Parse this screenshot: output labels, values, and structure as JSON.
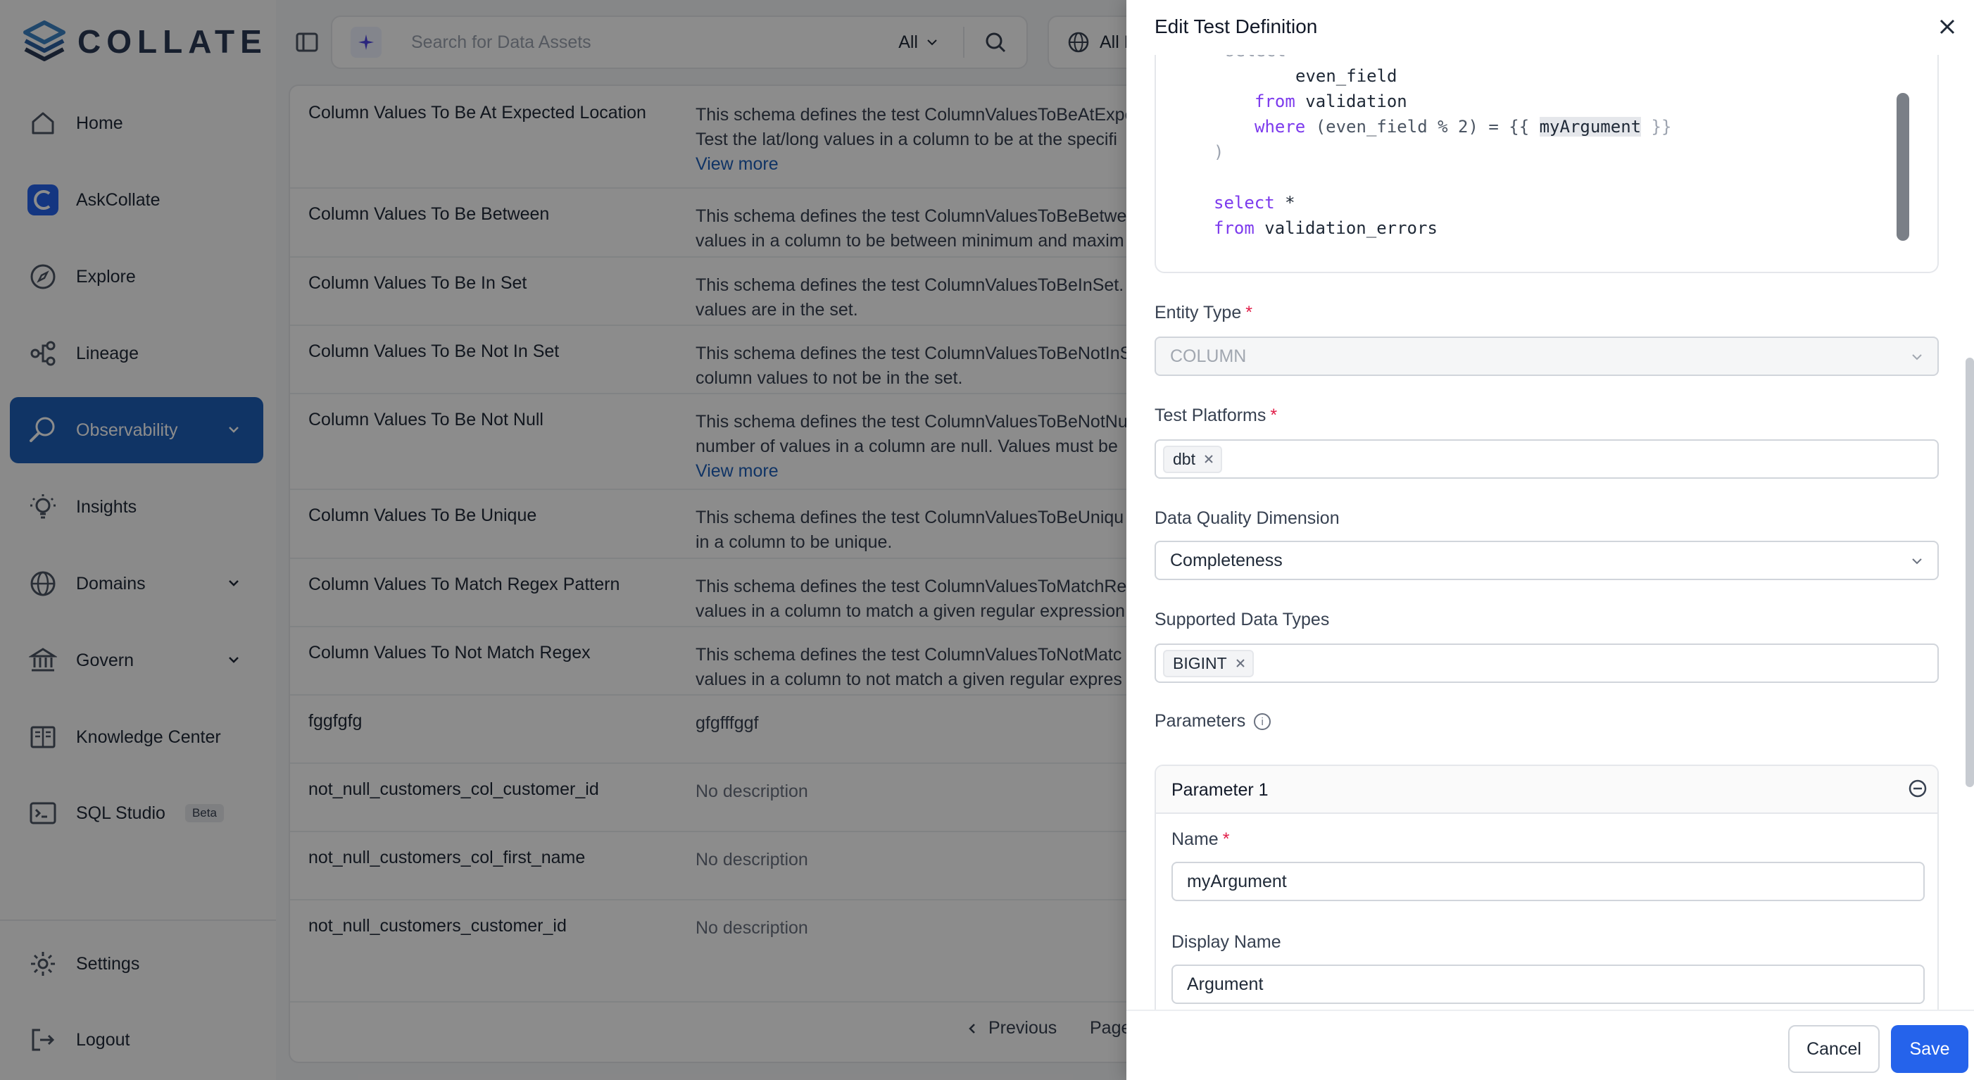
{
  "brand": {
    "name": "COLLATE"
  },
  "sidebar": {
    "items": [
      {
        "label": "Home",
        "icon": "home-icon"
      },
      {
        "label": "AskCollate",
        "icon": "askcollate-icon"
      },
      {
        "label": "Explore",
        "icon": "compass-icon"
      },
      {
        "label": "Lineage",
        "icon": "lineage-icon"
      },
      {
        "label": "Observability",
        "icon": "observability-icon",
        "active": true
      },
      {
        "label": "Insights",
        "icon": "bulb-icon"
      },
      {
        "label": "Domains",
        "icon": "globe-icon"
      },
      {
        "label": "Govern",
        "icon": "bank-icon"
      },
      {
        "label": "Knowledge Center",
        "icon": "book-icon"
      },
      {
        "label": "SQL Studio",
        "icon": "terminal-icon",
        "badge": "Beta"
      }
    ],
    "bottom": [
      {
        "label": "Settings",
        "icon": "gear-icon"
      },
      {
        "label": "Logout",
        "icon": "logout-icon"
      }
    ]
  },
  "topbar": {
    "search_placeholder": "Search for Data Assets",
    "search_scope": "All",
    "domain_label": "All D"
  },
  "table": {
    "rows": [
      {
        "name": "Column Values To Be At Expected Location",
        "desc": [
          "This schema defines the test ColumnValuesToBeAtExpe",
          "Test the lat/long values in a column to be at the specifi"
        ],
        "view_more": "View more"
      },
      {
        "name": "Column Values To Be Between",
        "desc": [
          "This schema defines the test ColumnValuesToBeBetwe",
          "values in a column to be between minimum and maxim"
        ]
      },
      {
        "name": "Column Values To Be In Set",
        "desc": [
          "This schema defines the test ColumnValuesToBeInSet.",
          "values are in the set."
        ]
      },
      {
        "name": "Column Values To Be Not In Set",
        "desc": [
          "This schema defines the test ColumnValuesToBeNotInS",
          "column values to not be in the set."
        ]
      },
      {
        "name": "Column Values To Be Not Null",
        "desc": [
          "This schema defines the test ColumnValuesToBeNotNu",
          "number of values in a column are null. Values must be"
        ],
        "view_more": "View more"
      },
      {
        "name": "Column Values To Be Unique",
        "desc": [
          "This schema defines the test ColumnValuesToBeUniqu",
          "in a column to be unique."
        ]
      },
      {
        "name": "Column Values To Match Regex Pattern",
        "desc": [
          "This schema defines the test ColumnValuesToMatchRe",
          "values in a column to match a given regular expression"
        ]
      },
      {
        "name": "Column Values To Not Match Regex",
        "desc": [
          "This schema defines the test ColumnValuesToNotMatc",
          "values in a column to not match a given regular expres"
        ]
      },
      {
        "name": "fggfgfg",
        "desc": [
          "gfgfffggf"
        ]
      },
      {
        "name": "not_null_customers_col_customer_id",
        "desc": [
          "No description"
        ],
        "muted": true
      },
      {
        "name": "not_null_customers_col_first_name",
        "desc": [
          "No description"
        ],
        "muted": true
      },
      {
        "name": "not_null_customers_customer_id",
        "desc": [
          "No description"
        ],
        "muted": true
      }
    ],
    "pager": {
      "previous": "Previous",
      "page": "Page"
    }
  },
  "drawer": {
    "title": "Edit Test Definition",
    "code": {
      "l_field": "even_field",
      "l_from_kw": "from",
      "l_from_val": "validation",
      "l_where_kw": "where",
      "l_where_expr": "(even_field % 2) = {{",
      "l_where_arg": "myArgument",
      "l_where_end": "}}",
      "l_close": ")",
      "l_select_kw": "select",
      "l_select_val": "*",
      "l_from2_kw": "from",
      "l_from2_val": "validation_errors"
    },
    "entity_type": {
      "label": "Entity Type",
      "value": "COLUMN"
    },
    "test_platforms": {
      "label": "Test Platforms",
      "tags": [
        "dbt"
      ]
    },
    "dq_dimension": {
      "label": "Data Quality Dimension",
      "value": "Completeness"
    },
    "data_types": {
      "label": "Supported Data Types",
      "tags": [
        "BIGINT"
      ]
    },
    "parameters": {
      "label": "Parameters",
      "items": [
        {
          "title": "Parameter 1",
          "name_label": "Name",
          "name_value": "myArgument",
          "display_label": "Display Name",
          "display_value": "Argument"
        }
      ]
    },
    "footer": {
      "cancel": "Cancel",
      "save": "Save"
    }
  },
  "colors": {
    "accent": "#1e5fb8",
    "primary_button": "#2563eb",
    "required": "#e11d48"
  }
}
